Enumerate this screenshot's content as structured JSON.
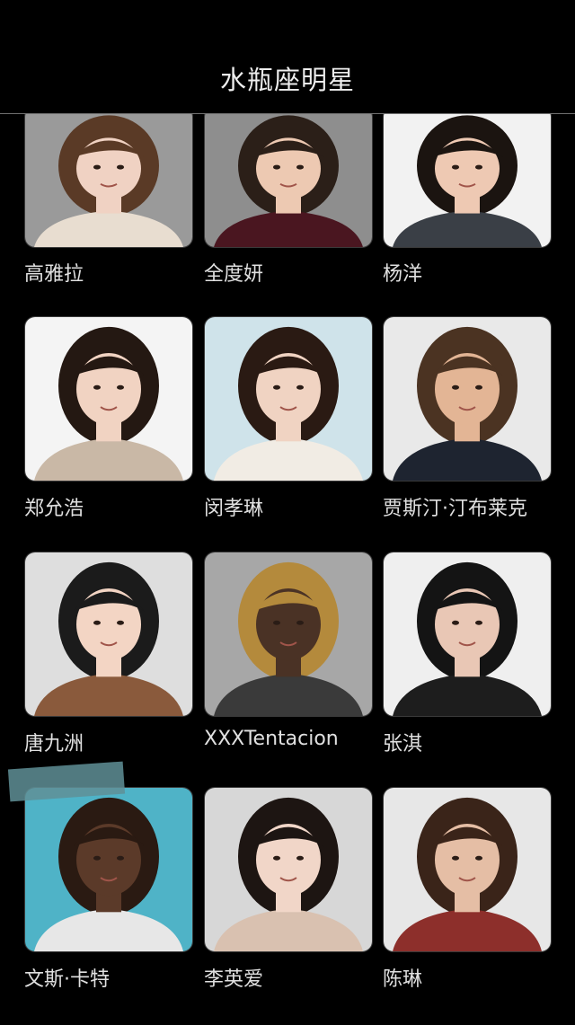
{
  "header": {
    "title": "水瓶座明星"
  },
  "celebrities": [
    {
      "name": "高雅拉",
      "bg": "#9a9a9a",
      "skin": "#f0d2c3",
      "hair": "#5a3a26",
      "shirt": "#e8ddd0"
    },
    {
      "name": "全度妍",
      "bg": "#8e8e8e",
      "skin": "#edc9b2",
      "hair": "#2b1f18",
      "shirt": "#4a1620"
    },
    {
      "name": "杨洋",
      "bg": "#f2f2f2",
      "skin": "#eec9b3",
      "hair": "#1b1410",
      "shirt": "#3a3f46"
    },
    {
      "name": "郑允浩",
      "bg": "#f4f4f4",
      "skin": "#f1d3c2",
      "hair": "#241812",
      "shirt": "#c9b8a6"
    },
    {
      "name": "闵孝琳",
      "bg": "#cfe3ea",
      "skin": "#f0d3c2",
      "hair": "#2a1a13",
      "shirt": "#f1ece4"
    },
    {
      "name": "贾斯汀·汀布莱克",
      "bg": "#e9e9e9",
      "skin": "#e3b595",
      "hair": "#4b3322",
      "shirt": "#1e2430"
    },
    {
      "name": "唐九洲",
      "bg": "#dedede",
      "skin": "#f3d5c4",
      "hair": "#1b1b1b",
      "shirt": "#8a5a3c"
    },
    {
      "name": "XXXTentacion",
      "bg": "#a7a7a7",
      "skin": "#4a3225",
      "hair": "#b48a3c",
      "shirt": "#3a3a3a"
    },
    {
      "name": "张淇",
      "bg": "#efefef",
      "skin": "#e9c7b5",
      "hair": "#141414",
      "shirt": "#1d1d1d"
    },
    {
      "name": "文斯·卡特",
      "bg": "#4fb3c7",
      "skin": "#5b3a29",
      "hair": "#2a1a12",
      "shirt": "#e7e7e7"
    },
    {
      "name": "李英爱",
      "bg": "#d7d7d7",
      "skin": "#f1d6c8",
      "hair": "#1d1512",
      "shirt": "#d9c1b0"
    },
    {
      "name": "陈琳",
      "bg": "#e7e7e7",
      "skin": "#e5bea5",
      "hair": "#3a2419",
      "shirt": "#8d2f2b"
    }
  ]
}
